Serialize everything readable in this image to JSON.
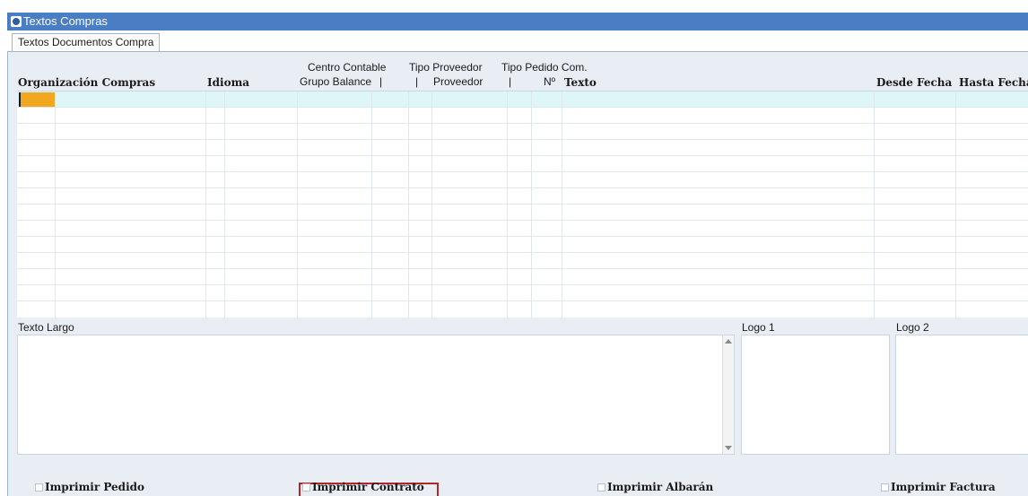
{
  "window": {
    "title": "Textos Compras"
  },
  "tabs": [
    {
      "label": "Textos Documentos Compra"
    }
  ],
  "grid": {
    "headers": {
      "organizacion": "Organización Compras",
      "idioma": "Idioma",
      "centro_top": "Centro Contable",
      "centro_bottom": "Grupo Balance",
      "pipe1": "|",
      "tipo_prov_top": "Tipo Proveedor",
      "pipe2": "|",
      "tipo_prov_bottom": "Proveedor",
      "tipo_pedido_top": "Tipo Pedido Com.",
      "pipe3": "|",
      "numero": "Nº",
      "texto": "Texto",
      "desde": "Desde Fecha",
      "hasta": "Hasta Fecha"
    },
    "rows": 13,
    "selected_row": 0
  },
  "texto_largo": {
    "label": "Texto Largo",
    "value": ""
  },
  "logos": [
    {
      "label": "Logo 1"
    },
    {
      "label": "Logo 2"
    }
  ],
  "print_options": [
    {
      "label": "Imprimir Pedido",
      "checked": false
    },
    {
      "label": "Imprimir Contrato",
      "checked": false,
      "highlighted": true
    },
    {
      "label": "Imprimir Albarán",
      "checked": false
    },
    {
      "label": "Imprimir Factura",
      "checked": false
    }
  ],
  "colors": {
    "titlebar": "#4a7ec4",
    "selected_row": "#dff6f8",
    "cursor": "#f2a720",
    "highlight_border": "#b3262a"
  }
}
